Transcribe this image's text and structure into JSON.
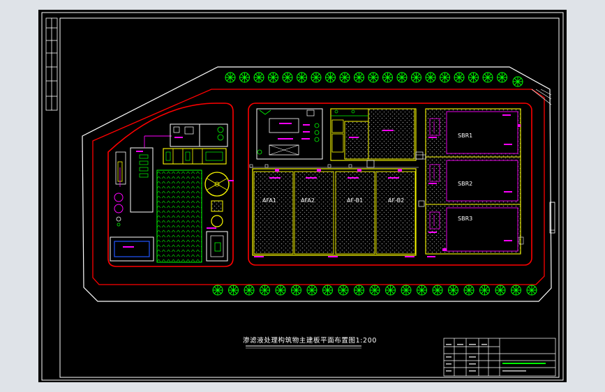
{
  "drawing": {
    "title": "渗滤液处理构筑物主建板平面布置图1:200",
    "units": {
      "afa1": "AFA1",
      "afa2": "AFA2",
      "afb1": "AF-B1",
      "afb2": "AF-B2",
      "sbr1": "SBR1",
      "sbr2": "SBR2",
      "sbr3": "SBR3"
    },
    "colors": {
      "background": "#000000",
      "frame": "#ffffff",
      "boundary": "#ff0000",
      "structures": "#ffff00",
      "annotation": "#ff00ff",
      "trees": "#00ff00",
      "page": "#dfe3e8"
    }
  }
}
